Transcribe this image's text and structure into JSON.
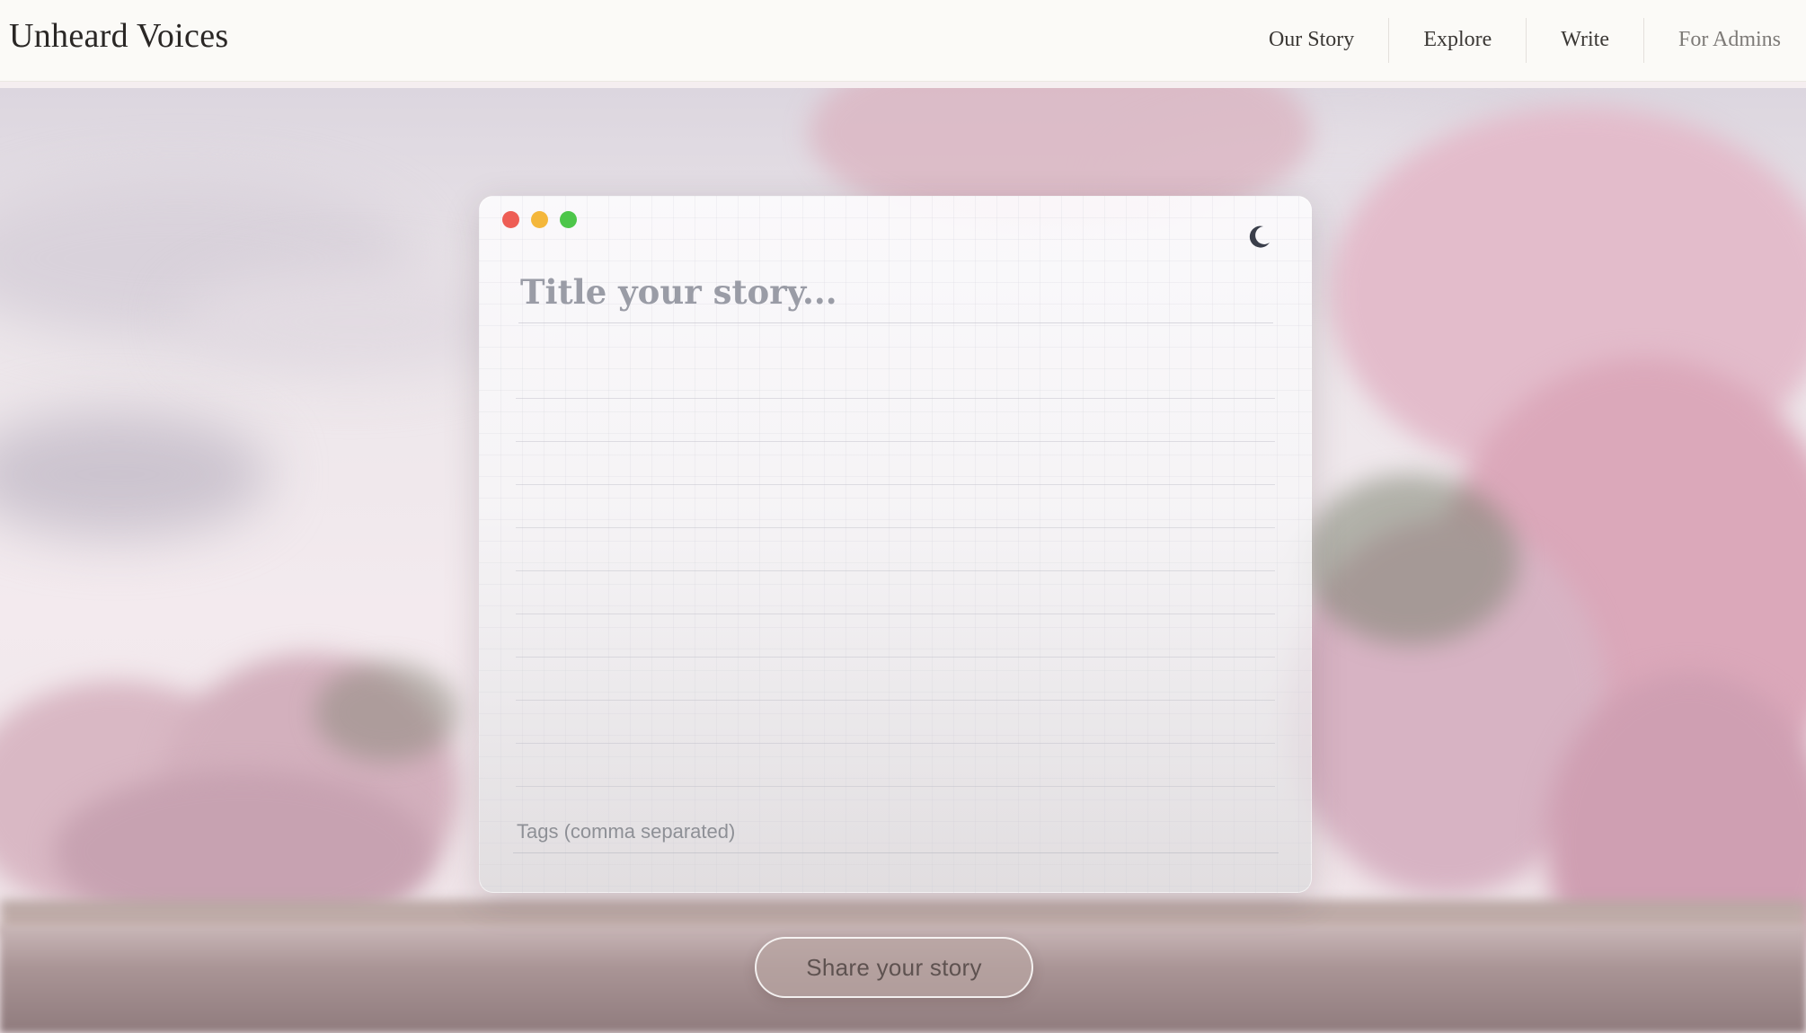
{
  "header": {
    "brand": "Unheard Voices",
    "nav": [
      {
        "label": "Our Story"
      },
      {
        "label": "Explore"
      },
      {
        "label": "Write"
      },
      {
        "label": "For Admins"
      }
    ]
  },
  "editor": {
    "window_controls": [
      "close",
      "minimize",
      "maximize"
    ],
    "theme_toggle_icon": "moon-icon",
    "title_placeholder": "Title your story...",
    "title_value": "",
    "body_value": "",
    "tags_placeholder": "Tags (comma separated)",
    "tags_value": ""
  },
  "actions": {
    "share_label": "Share your story"
  },
  "colors": {
    "close": "#ee5d55",
    "minimize": "#f4b73b",
    "maximize": "#4dc64a",
    "blossom_pink": "#e8bcc8"
  }
}
